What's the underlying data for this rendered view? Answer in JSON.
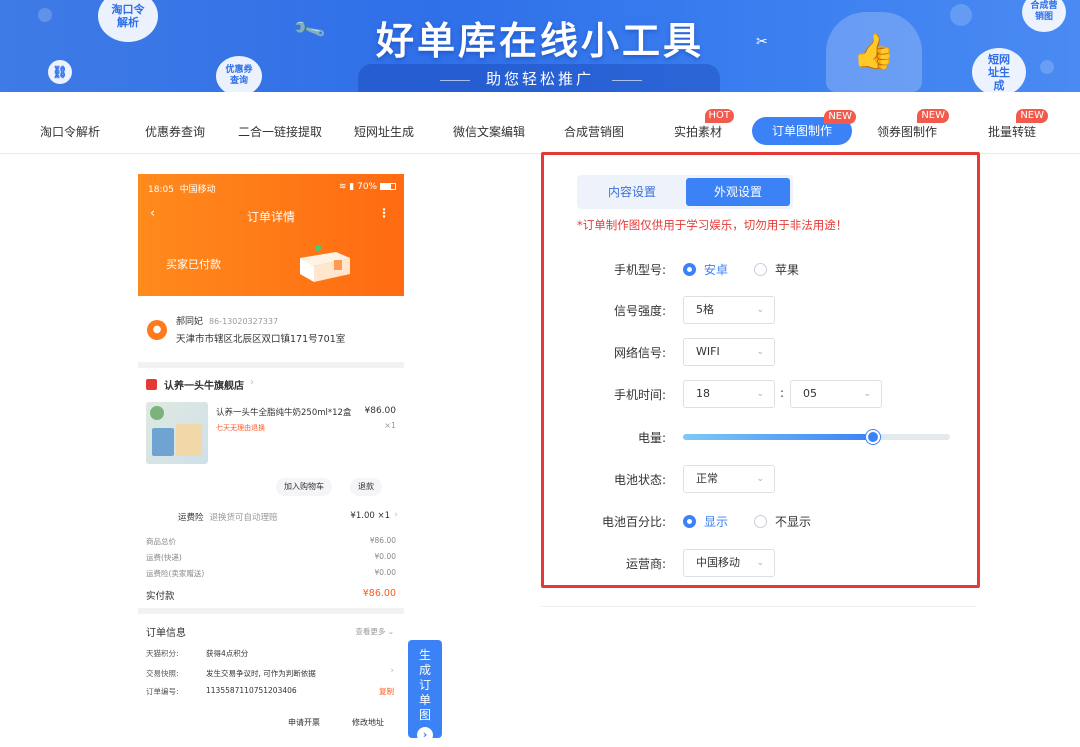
{
  "banner": {
    "title": "好单库在线小工具",
    "subtitle": "助您轻松推广",
    "bubbles": [
      "淘口令解析",
      "优惠券查询",
      "短网址生成",
      "合成营销图"
    ]
  },
  "nav": {
    "items": [
      {
        "label": "淘口令解析",
        "tag": ""
      },
      {
        "label": "优惠券查询",
        "tag": ""
      },
      {
        "label": "二合一链接提取",
        "tag": ""
      },
      {
        "label": "短网址生成",
        "tag": ""
      },
      {
        "label": "微信文案编辑",
        "tag": ""
      },
      {
        "label": "合成营销图",
        "tag": ""
      },
      {
        "label": "实拍素材",
        "tag": "HOT"
      },
      {
        "label": "订单图制作",
        "tag": "NEW",
        "active": true
      },
      {
        "label": "领券图制作",
        "tag": "NEW"
      },
      {
        "label": "批量转链",
        "tag": "NEW"
      }
    ]
  },
  "phone": {
    "status_time": "18:05",
    "status_carrier": "中国移动",
    "status_battery": "70%",
    "page_title": "订单详情",
    "paid_status": "买家已付款",
    "receiver_name": "郝同妃",
    "receiver_phone": "86-13020327337",
    "address": "天津市市辖区北辰区双口镇171号701室",
    "shop_name": "认养一头牛旗舰店",
    "product_name": "认养一头牛全脂纯牛奶250ml*12盒",
    "product_tag": "七天无理由退换",
    "product_price": "¥86.00",
    "product_qty": "×1",
    "btn_cart": "加入购物车",
    "btn_refund": "退款",
    "shipping_ins_label": "运费险",
    "shipping_ins_hint": "退换货可自动理赔",
    "shipping_ins_value": "¥1.00 ×1",
    "summary": [
      {
        "label": "商品总价",
        "value": "¥86.00"
      },
      {
        "label": "运费(快递)",
        "value": "¥0.00"
      },
      {
        "label": "运费险(卖家赠送)",
        "value": "¥0.00"
      }
    ],
    "paid_label": "实付款",
    "paid_value": "¥86.00",
    "order_info_title": "订单信息",
    "order_info_more": "查看更多",
    "order_rows": [
      {
        "label": "天猫积分:",
        "value": "获得4点积分"
      },
      {
        "label": "交易快照:",
        "value": "发生交易争议时, 可作为判断依据"
      },
      {
        "label": "订单编号:",
        "value": "1135587110751203406"
      }
    ],
    "copy_label": "复制",
    "btn_invoice": "申请开票",
    "btn_modify_address": "修改地址"
  },
  "generate_button": {
    "label": "生成订单图",
    "arrow": "›"
  },
  "panel": {
    "tabs": [
      "内容设置",
      "外观设置"
    ],
    "active_tab": 1,
    "warning": "*订单制作图仅供用于学习娱乐，切勿用于非法用途！",
    "phone_model_label": "手机型号:",
    "phone_model_options": [
      "安卓",
      "苹果"
    ],
    "phone_model_selected": "安卓",
    "signal_label": "信号强度:",
    "signal_value": "5格",
    "network_label": "网络信号:",
    "network_value": "WIFI",
    "time_label": "手机时间:",
    "time_hour": "18",
    "time_sep": ":",
    "time_minute": "05",
    "battery_label": "电量:",
    "battery_level": 0.71,
    "battery_state_label": "电池状态:",
    "battery_state_value": "正常",
    "battery_percent_label": "电池百分比:",
    "battery_percent_options": [
      "显示",
      "不显示"
    ],
    "battery_percent_selected": "显示",
    "carrier_label": "运营商:",
    "carrier_value": "中国移动"
  },
  "colors": {
    "accent": "#3b82f6",
    "hot_tag": "#f25b4c",
    "orange": "#ff6a12",
    "warn": "#e53935"
  }
}
